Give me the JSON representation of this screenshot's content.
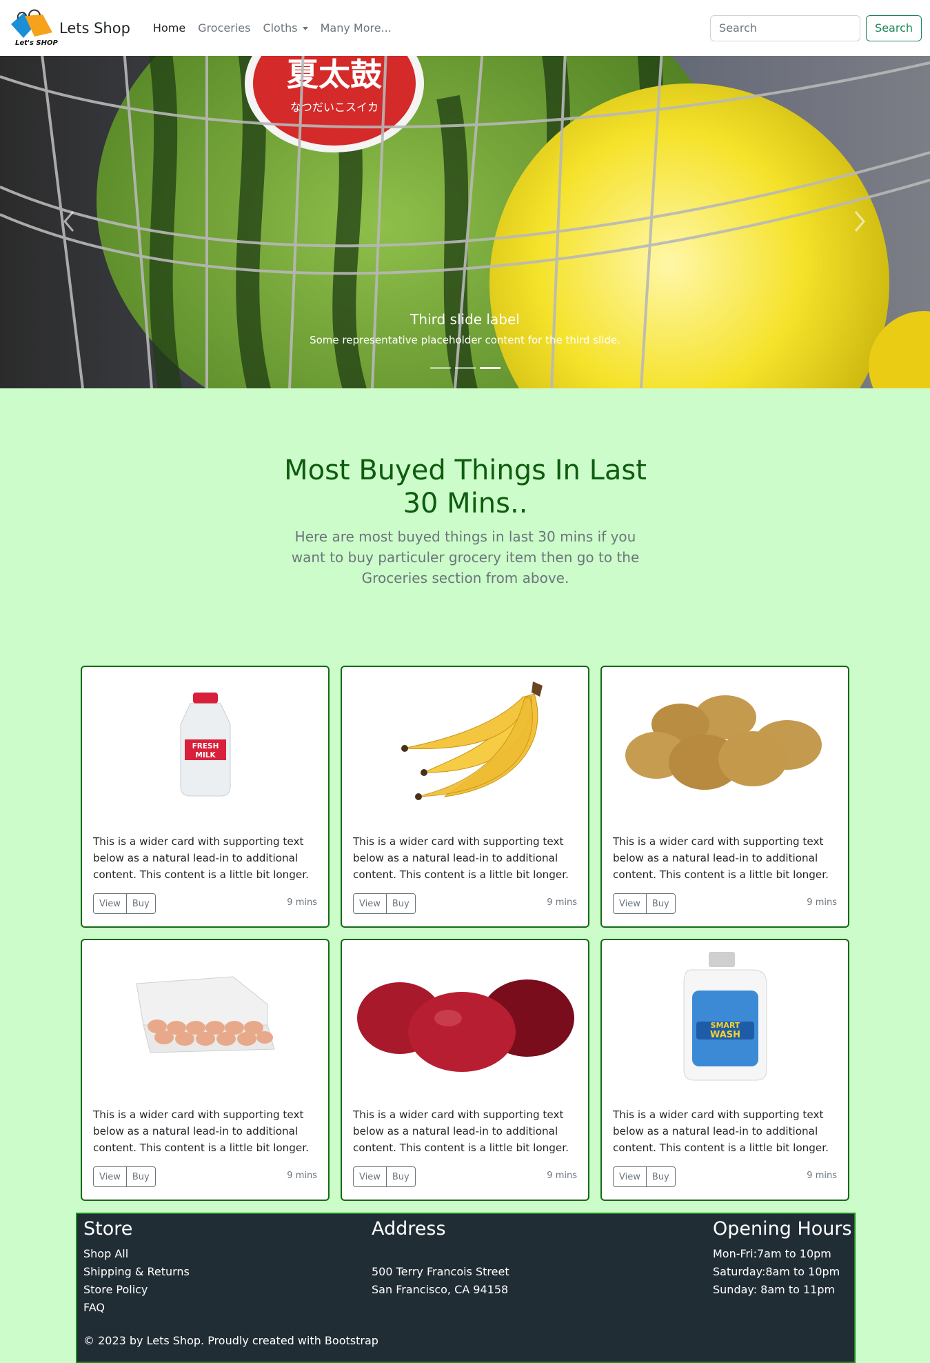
{
  "navbar": {
    "logo_text": "Let's SHOP",
    "brand": "Lets Shop",
    "links": [
      {
        "label": "Home",
        "active": true
      },
      {
        "label": "Groceries",
        "active": false
      },
      {
        "label": "Cloths",
        "active": false,
        "dropdown": true
      },
      {
        "label": "Many More...",
        "active": false
      }
    ],
    "search_placeholder": "Search",
    "search_button": "Search"
  },
  "carousel": {
    "label_text": "夏太鼓",
    "label_subtext": "なつだいこスイカ",
    "caption_title": "Third slide label",
    "caption_text": "Some representative placeholder content for the third slide.",
    "slide_count": 3,
    "active_slide": 3,
    "prev_icon": "chevron-left-icon",
    "next_icon": "chevron-right-icon"
  },
  "section": {
    "title": "Most Buyed Things In Last 30 Mins..",
    "subtitle": "Here are most buyed things in last 30 mins if you want to buy particuler grocery item then go to the Groceries section from above."
  },
  "cards": [
    {
      "product": "milk-bottle",
      "label": "FRESH MILK",
      "text": "This is a wider card with supporting text below as a natural lead-in to additional content. This content is a little bit longer.",
      "view": "View",
      "buy": "Buy",
      "time": "9 mins"
    },
    {
      "product": "bananas",
      "text": "This is a wider card with supporting text below as a natural lead-in to additional content. This content is a little bit longer.",
      "view": "View",
      "buy": "Buy",
      "time": "9 mins"
    },
    {
      "product": "potatoes",
      "text": "This is a wider card with supporting text below as a natural lead-in to additional content. This content is a little bit longer.",
      "view": "View",
      "buy": "Buy",
      "time": "9 mins"
    },
    {
      "product": "eggs",
      "text": "This is a wider card with supporting text below as a natural lead-in to additional content. This content is a little bit longer.",
      "view": "View",
      "buy": "Buy",
      "time": "9 mins"
    },
    {
      "product": "apples",
      "text": "This is a wider card with supporting text below as a natural lead-in to additional content. This content is a little bit longer.",
      "view": "View",
      "buy": "Buy",
      "time": "9 mins"
    },
    {
      "product": "detergent",
      "label": "SMART WASH",
      "text": "This is a wider card with supporting text below as a natural lead-in to additional content. This content is a little bit longer.",
      "view": "View",
      "buy": "Buy",
      "time": "9 mins"
    }
  ],
  "footer": {
    "store": {
      "title": "Store",
      "links": [
        "Shop All",
        "Shipping & Returns",
        "Store Policy",
        "FAQ"
      ]
    },
    "address": {
      "title": "Address",
      "lines": [
        "500 Terry Francois Street",
        "San Francisco, CA 94158"
      ]
    },
    "hours": {
      "title": "Opening Hours",
      "lines": [
        "Mon-Fri:7am to 10pm",
        "Saturday:8am to 10pm",
        "Sunday: 8am to 11pm"
      ]
    },
    "copyright": "© 2023 by Lets Shop. Proudly created with Bootstrap"
  }
}
